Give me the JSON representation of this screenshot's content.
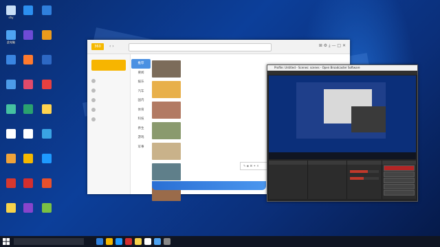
{
  "desktop": {
    "icons": [
      {
        "label": "shy",
        "color": "#c9dff7"
      },
      {
        "label": "此电脑",
        "color": "#4ea3f1"
      },
      {
        "label": "",
        "color": "#3a85e1"
      },
      {
        "label": "",
        "color": "#4c9be9"
      },
      {
        "label": "",
        "color": "#45c1a1"
      },
      {
        "label": "",
        "color": "#ffffff"
      },
      {
        "label": "",
        "color": "#f0a33a"
      },
      {
        "label": "",
        "color": "#d7382f"
      },
      {
        "label": "",
        "color": "#f7d24a"
      },
      {
        "label": "",
        "color": "#2c8ff0"
      },
      {
        "label": "",
        "color": "#6d4bd6"
      },
      {
        "label": "",
        "color": "#ff7a2e"
      },
      {
        "label": "",
        "color": "#e04a6a"
      },
      {
        "label": "",
        "color": "#2aa26f"
      },
      {
        "label": "",
        "color": "#ffffff"
      },
      {
        "label": "",
        "color": "#f5b800"
      },
      {
        "label": "",
        "color": "#d42f2f"
      },
      {
        "label": "",
        "color": "#8844cc"
      },
      {
        "label": "",
        "color": "#2f7fdc"
      },
      {
        "label": "",
        "color": "#eb9b1c"
      },
      {
        "label": "",
        "color": "#2d68c4"
      },
      {
        "label": "",
        "color": "#e64040"
      },
      {
        "label": "",
        "color": "#ffd34f"
      },
      {
        "label": "",
        "color": "#3aa4e4"
      },
      {
        "label": "",
        "color": "#1e9aff"
      },
      {
        "label": "",
        "color": "#e8502c"
      },
      {
        "label": "",
        "color": "#7ac143"
      }
    ]
  },
  "browser": {
    "logo": "360",
    "address_placeholder": "",
    "sidebar": {
      "brand": "",
      "items": [
        "",
        "",
        "",
        "",
        ""
      ]
    },
    "categories": [
      "推荐",
      "要闻",
      "娱乐",
      "汽车",
      "国内",
      "体育",
      "科技",
      "养生",
      "游戏",
      "军事"
    ],
    "feed": [
      {
        "title": "",
        "thumb": "#7c6c5a"
      },
      {
        "title": "",
        "thumb": "#e8b04a"
      },
      {
        "title": "",
        "thumb": "#b27a63"
      },
      {
        "title": "",
        "thumb": "#8a9a6e"
      },
      {
        "title": "",
        "thumb": "#c9b28a"
      },
      {
        "title": "",
        "thumb": "#5f7f8a"
      },
      {
        "title": "",
        "thumb": "#9a6b4a"
      }
    ],
    "banner": ""
  },
  "obs": {
    "title": "Profile: Untitled - Scenes: scenes - Open Broadcaster Software",
    "menu": "",
    "docks": [
      {
        "title": ""
      },
      {
        "title": ""
      },
      {
        "title": ""
      },
      {
        "title": ""
      }
    ],
    "controls": [
      "",
      "",
      "",
      "",
      ""
    ],
    "status": ""
  },
  "taskbar": {
    "search_text": "",
    "icon_colors": [
      "#2f7fdc",
      "#f5b800",
      "#1e9aff",
      "#d42f2f",
      "#f7d24a",
      "#ffffff",
      "#4ea3f1",
      "#888888"
    ],
    "clock_time": "",
    "clock_date": ""
  }
}
